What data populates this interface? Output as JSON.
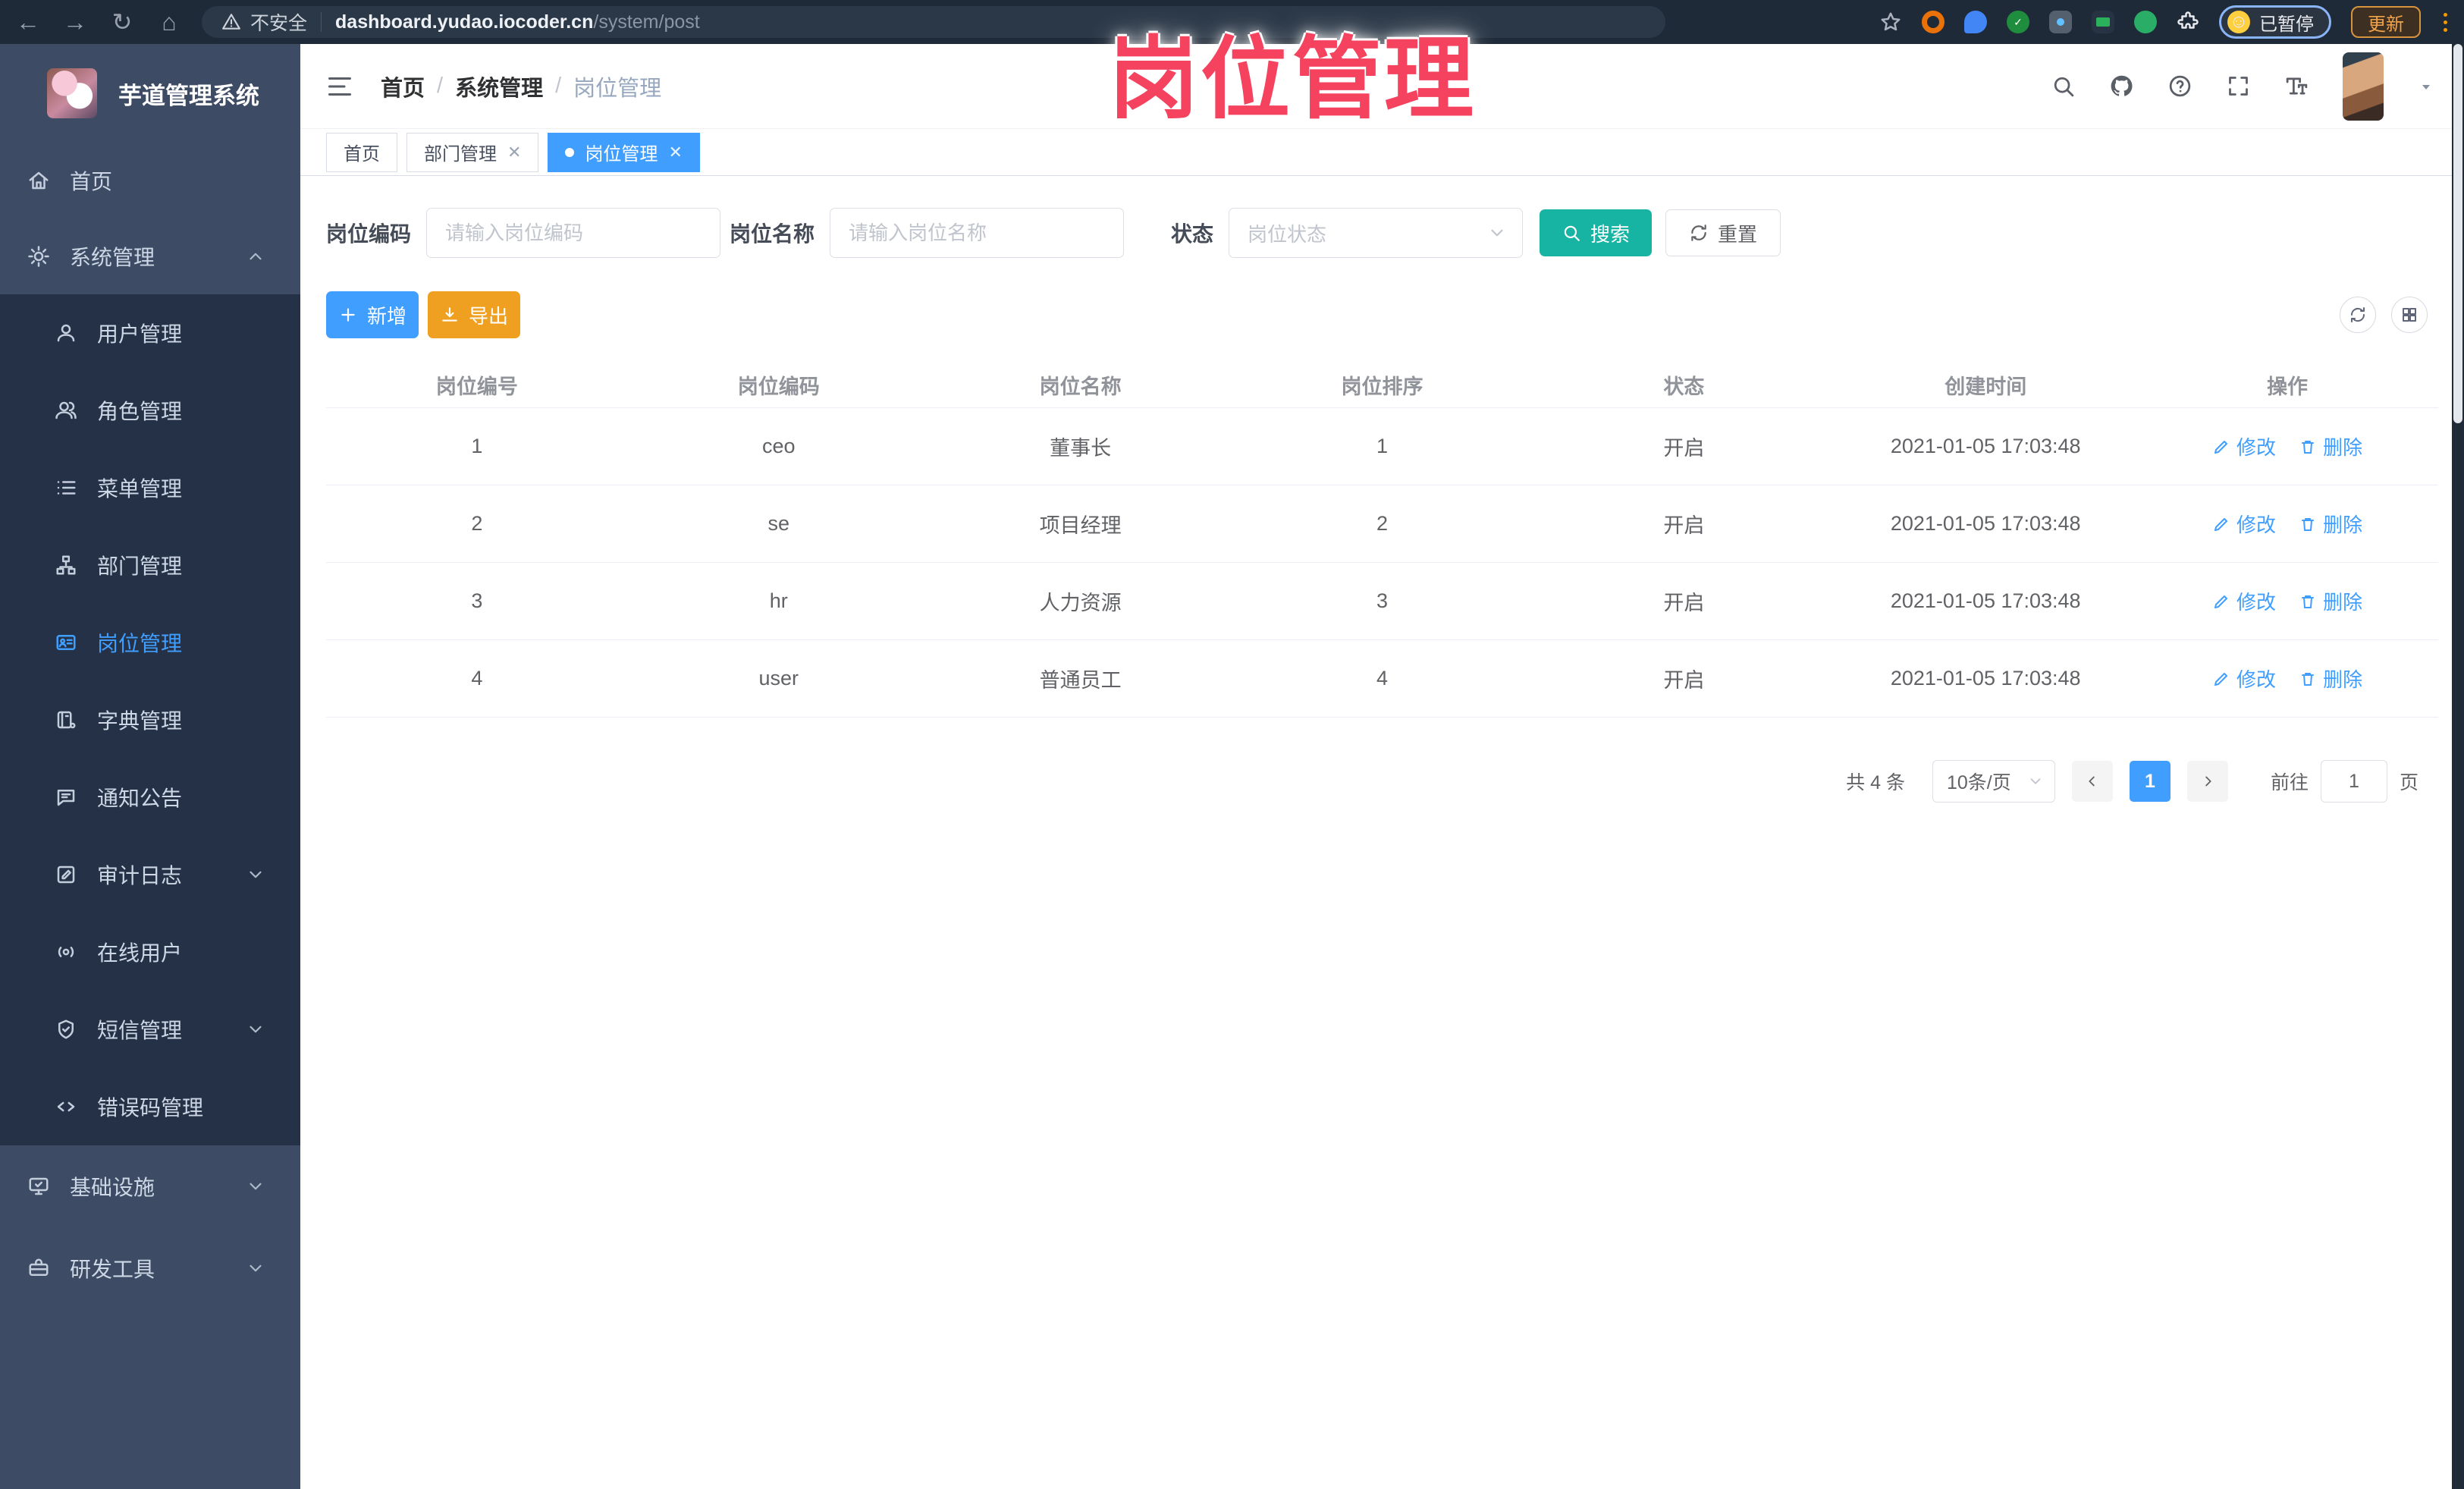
{
  "overlay_title": "岗位管理",
  "browser": {
    "security_label": "不安全",
    "url_host": "dashboard.yudao.iocoder.cn",
    "url_path": "/system/post",
    "profile_chip": "已暂停",
    "update_button": "更新"
  },
  "sidebar": {
    "logo_title": "芋道管理系统",
    "items": [
      {
        "label": "首页"
      },
      {
        "label": "系统管理"
      },
      {
        "label": "用户管理"
      },
      {
        "label": "角色管理"
      },
      {
        "label": "菜单管理"
      },
      {
        "label": "部门管理"
      },
      {
        "label": "岗位管理"
      },
      {
        "label": "字典管理"
      },
      {
        "label": "通知公告"
      },
      {
        "label": "审计日志"
      },
      {
        "label": "在线用户"
      },
      {
        "label": "短信管理"
      },
      {
        "label": "错误码管理"
      },
      {
        "label": "基础设施"
      },
      {
        "label": "研发工具"
      }
    ]
  },
  "header": {
    "breadcrumb": [
      "首页",
      "系统管理",
      "岗位管理"
    ]
  },
  "tabs": [
    {
      "label": "首页"
    },
    {
      "label": "部门管理"
    },
    {
      "label": "岗位管理"
    }
  ],
  "filters": {
    "code_label": "岗位编码",
    "code_placeholder": "请输入岗位编码",
    "name_label": "岗位名称",
    "name_placeholder": "请输入岗位名称",
    "status_label": "状态",
    "status_placeholder": "岗位状态",
    "search_button": "搜索",
    "reset_button": "重置"
  },
  "toolbar": {
    "add_button": "新增",
    "export_button": "导出"
  },
  "table": {
    "columns": [
      "岗位编号",
      "岗位编码",
      "岗位名称",
      "岗位排序",
      "状态",
      "创建时间",
      "操作"
    ],
    "rows": [
      {
        "id": "1",
        "code": "ceo",
        "name": "董事长",
        "sort": "1",
        "status": "开启",
        "created": "2021-01-05 17:03:48"
      },
      {
        "id": "2",
        "code": "se",
        "name": "项目经理",
        "sort": "2",
        "status": "开启",
        "created": "2021-01-05 17:03:48"
      },
      {
        "id": "3",
        "code": "hr",
        "name": "人力资源",
        "sort": "3",
        "status": "开启",
        "created": "2021-01-05 17:03:48"
      },
      {
        "id": "4",
        "code": "user",
        "name": "普通员工",
        "sort": "4",
        "status": "开启",
        "created": "2021-01-05 17:03:48"
      }
    ],
    "actions": {
      "edit": "修改",
      "delete": "删除"
    }
  },
  "pagination": {
    "total": "共 4 条",
    "page_size": "10条/页",
    "current_page": "1",
    "goto_label": "前往",
    "goto_value": "1",
    "unit_label": "页"
  },
  "colors": {
    "accent": "#409eff",
    "search_button": "#17b3a3",
    "export_button": "#f0a020",
    "overlay_title": "#f4425f",
    "sidebar_bg": "#3d4b64",
    "submenu_bg": "#253147"
  }
}
